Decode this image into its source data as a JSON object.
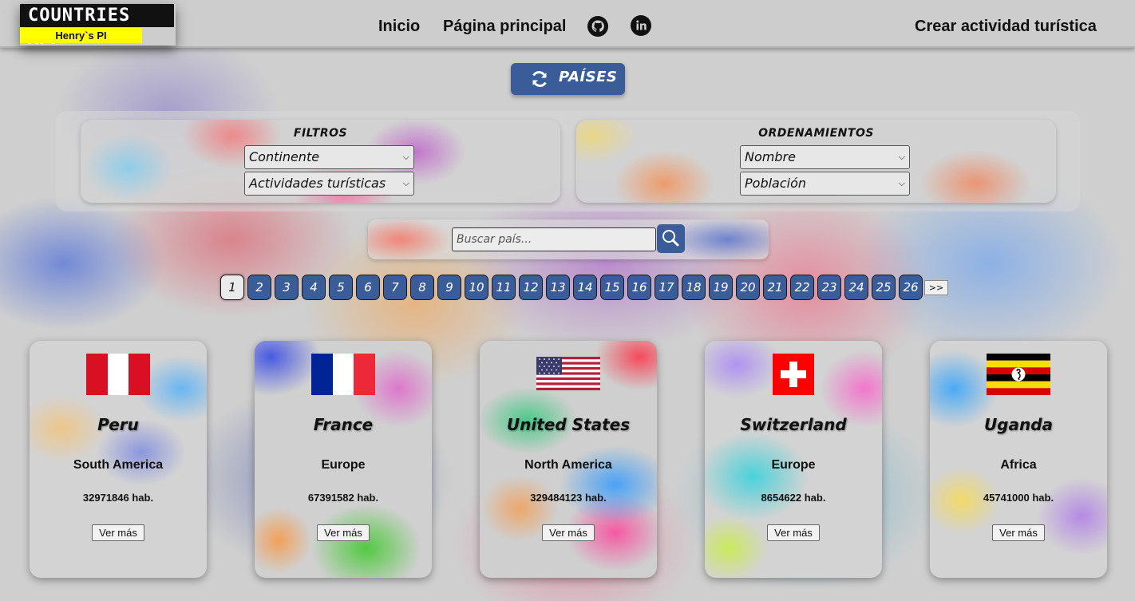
{
  "header": {
    "logo_title": "COUNTRIES APP",
    "logo_subtitle": "Henry`s PI",
    "nav": {
      "home": "Inicio",
      "main": "Página principal",
      "create": "Crear actividad turística"
    },
    "icons": [
      "github-icon",
      "linkedin-icon"
    ]
  },
  "refresh_button": {
    "label": "PAÍSES",
    "icon": "refresh-icon"
  },
  "filters": {
    "title": "FILTROS",
    "continent_selected": "Continente",
    "activity_selected": "Actividades turísticas"
  },
  "sorting": {
    "title": "ORDENAMIENTOS",
    "name_selected": "Nombre",
    "population_selected": "Población"
  },
  "search": {
    "placeholder": "Buscar país...",
    "icon": "search-icon"
  },
  "pagination": {
    "current": 1,
    "pages": [
      "1",
      "2",
      "3",
      "4",
      "5",
      "6",
      "7",
      "8",
      "9",
      "10",
      "11",
      "12",
      "13",
      "14",
      "15",
      "16",
      "17",
      "18",
      "19",
      "20",
      "21",
      "22",
      "23",
      "24",
      "25",
      "26"
    ],
    "next_label": ">>"
  },
  "cards": [
    {
      "name": "Peru",
      "continent": "South America",
      "population": "32971846 hab.",
      "button": "Ver más",
      "flag": "peru-flag"
    },
    {
      "name": "France",
      "continent": "Europe",
      "population": "67391582 hab.",
      "button": "Ver más",
      "flag": "france-flag"
    },
    {
      "name": "United States",
      "continent": "North America",
      "population": "329484123 hab.",
      "button": "Ver más",
      "flag": "usa-flag"
    },
    {
      "name": "Switzerland",
      "continent": "Europe",
      "population": "8654622 hab.",
      "button": "Ver más",
      "flag": "switzerland-flag"
    },
    {
      "name": "Uganda",
      "continent": "Africa",
      "population": "45741000 hab.",
      "button": "Ver más",
      "flag": "uganda-flag"
    }
  ],
  "colors": {
    "accent": "#3a5d99",
    "header_bg": "#cdcdcd",
    "logo_yellow": "#ffff00"
  }
}
